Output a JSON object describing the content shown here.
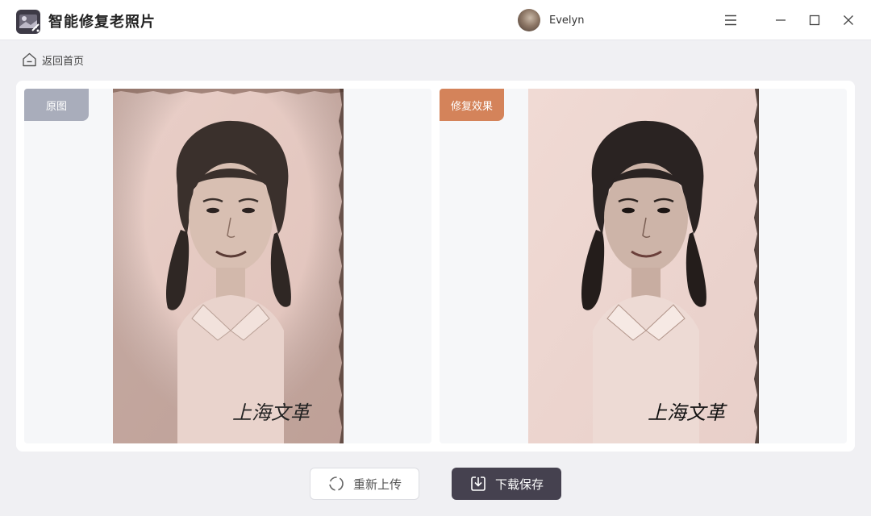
{
  "app": {
    "title": "智能修复老照片",
    "logo_icon": "photo-magic-icon"
  },
  "user": {
    "name": "Evelyn"
  },
  "window_controls": {
    "menu_icon": "menu-icon",
    "minimize_icon": "minimize-icon",
    "maximize_icon": "maximize-icon",
    "close_icon": "close-icon"
  },
  "nav": {
    "back_label": "返回首页",
    "back_icon": "home-icon"
  },
  "compare": {
    "original": {
      "badge": "原图",
      "badge_color": "#a9adbb",
      "caption": "上海文革"
    },
    "restored": {
      "badge": "修复效果",
      "badge_color": "#d4835a",
      "caption": "上海文革"
    }
  },
  "actions": {
    "reupload_label": "重新上传",
    "reupload_icon": "refresh-icon",
    "save_label": "下载保存",
    "save_icon": "download-icon",
    "save_color": "#45414f"
  }
}
